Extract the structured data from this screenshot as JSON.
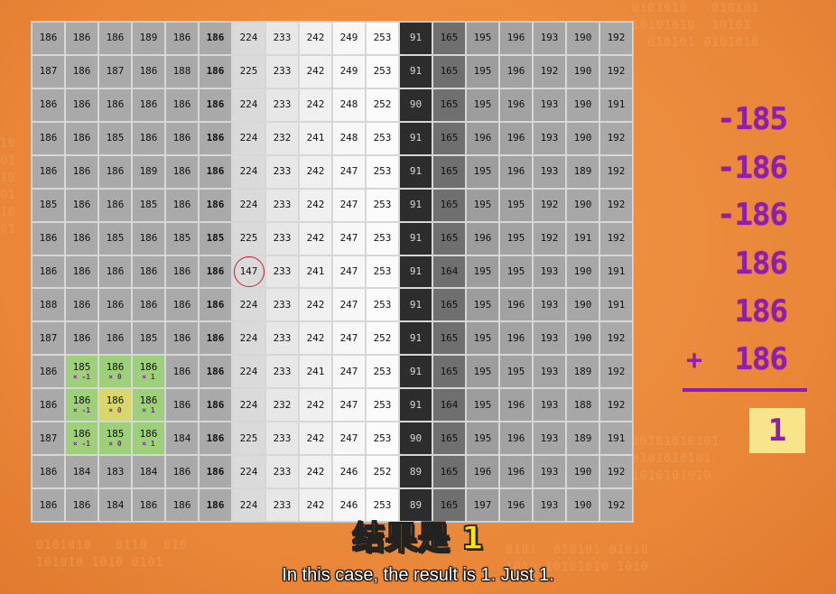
{
  "grid": {
    "rows": [
      [
        "186",
        "186",
        "186",
        "189",
        "186",
        "186",
        "224",
        "233",
        "242",
        "249",
        "253",
        "91",
        "165",
        "195",
        "196",
        "193",
        "190",
        "192"
      ],
      [
        "187",
        "186",
        "187",
        "186",
        "188",
        "186",
        "225",
        "233",
        "242",
        "249",
        "253",
        "91",
        "165",
        "195",
        "196",
        "192",
        "190",
        "192"
      ],
      [
        "186",
        "186",
        "186",
        "186",
        "186",
        "186",
        "224",
        "233",
        "242",
        "248",
        "252",
        "90",
        "165",
        "195",
        "196",
        "193",
        "190",
        "191"
      ],
      [
        "186",
        "186",
        "185",
        "186",
        "186",
        "186",
        "224",
        "232",
        "241",
        "248",
        "253",
        "91",
        "165",
        "196",
        "196",
        "193",
        "190",
        "192"
      ],
      [
        "186",
        "186",
        "186",
        "189",
        "186",
        "186",
        "224",
        "233",
        "242",
        "247",
        "253",
        "91",
        "165",
        "195",
        "196",
        "193",
        "189",
        "192"
      ],
      [
        "185",
        "186",
        "186",
        "185",
        "186",
        "186",
        "224",
        "233",
        "242",
        "247",
        "253",
        "91",
        "165",
        "195",
        "195",
        "192",
        "190",
        "192"
      ],
      [
        "186",
        "186",
        "185",
        "186",
        "185",
        "185",
        "225",
        "233",
        "242",
        "247",
        "253",
        "91",
        "165",
        "196",
        "195",
        "192",
        "191",
        "192"
      ],
      [
        "186",
        "186",
        "186",
        "186",
        "186",
        "186",
        "147",
        "233",
        "241",
        "247",
        "253",
        "91",
        "164",
        "195",
        "195",
        "193",
        "190",
        "191"
      ],
      [
        "188",
        "186",
        "186",
        "186",
        "186",
        "186",
        "224",
        "233",
        "242",
        "247",
        "253",
        "91",
        "165",
        "195",
        "196",
        "193",
        "190",
        "191"
      ],
      [
        "187",
        "186",
        "186",
        "185",
        "186",
        "186",
        "224",
        "233",
        "242",
        "247",
        "252",
        "91",
        "165",
        "195",
        "196",
        "193",
        "190",
        "192"
      ],
      [
        "186",
        "185",
        "186",
        "186",
        "186",
        "186",
        "224",
        "233",
        "241",
        "247",
        "253",
        "91",
        "165",
        "195",
        "195",
        "193",
        "189",
        "192"
      ],
      [
        "186",
        "186",
        "186",
        "186",
        "186",
        "186",
        "224",
        "232",
        "242",
        "247",
        "253",
        "91",
        "164",
        "195",
        "196",
        "193",
        "188",
        "192"
      ],
      [
        "187",
        "186",
        "185",
        "186",
        "184",
        "186",
        "225",
        "233",
        "242",
        "247",
        "253",
        "90",
        "165",
        "195",
        "196",
        "193",
        "189",
        "191"
      ],
      [
        "186",
        "184",
        "183",
        "184",
        "186",
        "186",
        "224",
        "233",
        "242",
        "246",
        "252",
        "89",
        "165",
        "196",
        "196",
        "193",
        "190",
        "192"
      ],
      [
        "186",
        "186",
        "184",
        "186",
        "186",
        "186",
        "224",
        "233",
        "242",
        "246",
        "253",
        "89",
        "165",
        "197",
        "196",
        "193",
        "190",
        "192"
      ]
    ],
    "weights": {
      "10": {
        "1": "× -1",
        "2": "× 0",
        "3": "× 1"
      },
      "11": {
        "1": "× -1",
        "2": "× 0",
        "3": "× 1"
      },
      "12": {
        "1": "× -1",
        "2": "× 0",
        "3": "× 1"
      }
    },
    "colors": {
      "col_shades": [
        "#a9a9a9",
        "#a9a9a9",
        "#a9a9a9",
        "#a9a9a9",
        "#a9a9a9",
        "#a9a9a9",
        "#dadada",
        "#e7e7e7",
        "#f0f0f0",
        "#f7f7f7",
        "#fbfbfb",
        "#2d2d2d",
        "#6f6f6f",
        "#9d9d9d",
        "#a2a2a2",
        "#a5a5a5",
        "#a7a7a7",
        "#a9a9a9"
      ],
      "kernel_green": "#9ed07a",
      "kernel_center": "#d9d66a",
      "dark_text": "#d9d9d9",
      "highlight_ring": "#c0242a"
    },
    "highlighted_value": "147"
  },
  "calc": {
    "terms": [
      "-185",
      "-186",
      "-186",
      "186",
      "186",
      "186"
    ],
    "plus_sign": "+",
    "result": "1",
    "color": "#8e1fae"
  },
  "subtitles": {
    "zh": "结果是 1",
    "en": "In this case, the result is 1. Just 1."
  }
}
